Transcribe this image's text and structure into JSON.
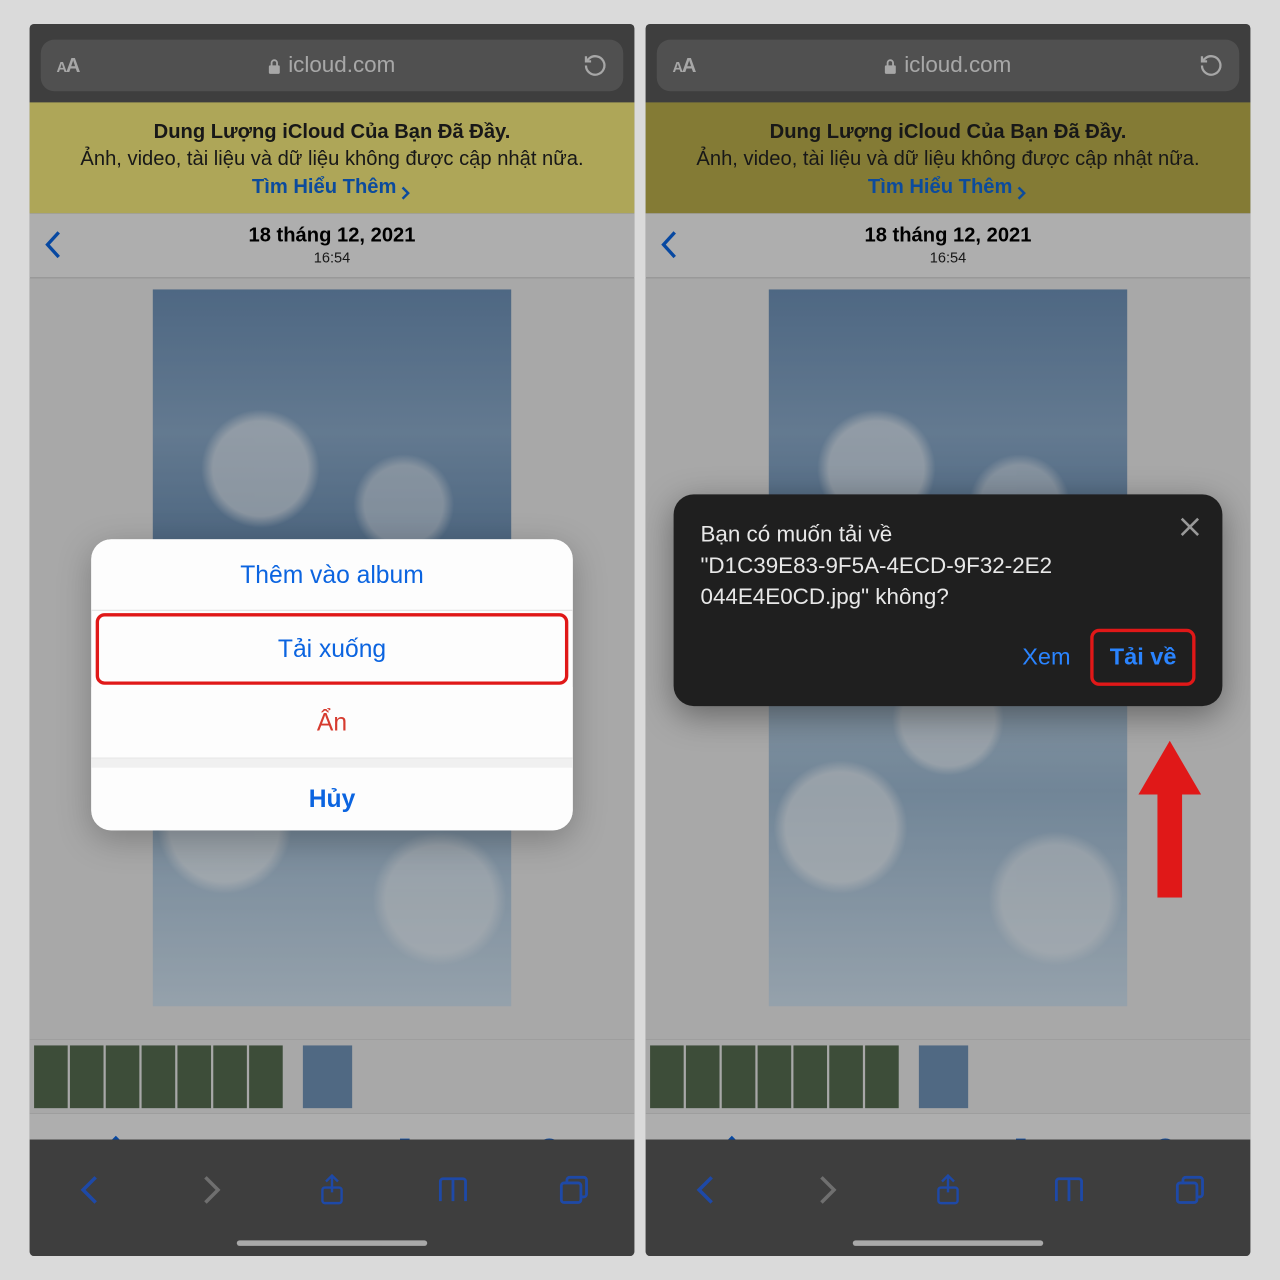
{
  "url_bar": {
    "domain": "icloud.com"
  },
  "banner": {
    "title": "Dung Lượng iCloud Của Bạn Đã Đầy.",
    "subtitle": "Ảnh, video, tài liệu và dữ liệu không được cập nhật nữa.",
    "link": "Tìm Hiểu Thêm"
  },
  "header": {
    "date": "18 tháng 12, 2021",
    "time": "16:54"
  },
  "action_sheet": {
    "add_to_album": "Thêm vào album",
    "download": "Tải xuống",
    "hide": "Ẩn",
    "cancel": "Hủy"
  },
  "download_prompt": {
    "line1": "Bạn có muốn tải về",
    "line2": "\"D1C39E83-9F5A-4ECD-9F32-2E2",
    "line3": "044E4E0CD.jpg\" không?",
    "view": "Xem",
    "download": "Tải về"
  }
}
